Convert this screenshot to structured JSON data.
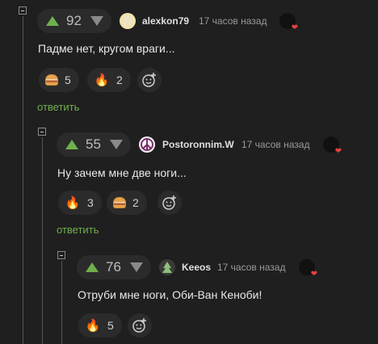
{
  "comments": [
    {
      "score": "92",
      "author": "alexkon79",
      "avatar_icon": "fire-face-icon",
      "time": "17 часов назад",
      "text": "Падме нет, кругом враги...",
      "reactions": [
        {
          "icon": "burger-icon",
          "count": "5"
        },
        {
          "icon": "fire-icon",
          "count": "2"
        }
      ],
      "reply_label": "ответить"
    },
    {
      "score": "55",
      "author": "Postoronnim.W",
      "avatar_icon": "peace-icon",
      "time": "17 часов назад",
      "text": "Ну зачем мне две ноги...",
      "reactions": [
        {
          "icon": "fire-icon",
          "count": "3"
        },
        {
          "icon": "burger-icon",
          "count": "2"
        }
      ],
      "reply_label": "ответить"
    },
    {
      "score": "76",
      "author": "Keeos",
      "avatar_icon": "tree-icon",
      "time": "17 часов назад",
      "text": "Отруби мне ноги, Оби-Ван Кеноби!",
      "reactions": [
        {
          "icon": "fire-icon",
          "count": "5"
        }
      ]
    }
  ],
  "colors": {
    "background": "#1f1f1f",
    "upvote": "#6fb04d",
    "reply": "#6fb04d",
    "heart": "#e8423f"
  }
}
